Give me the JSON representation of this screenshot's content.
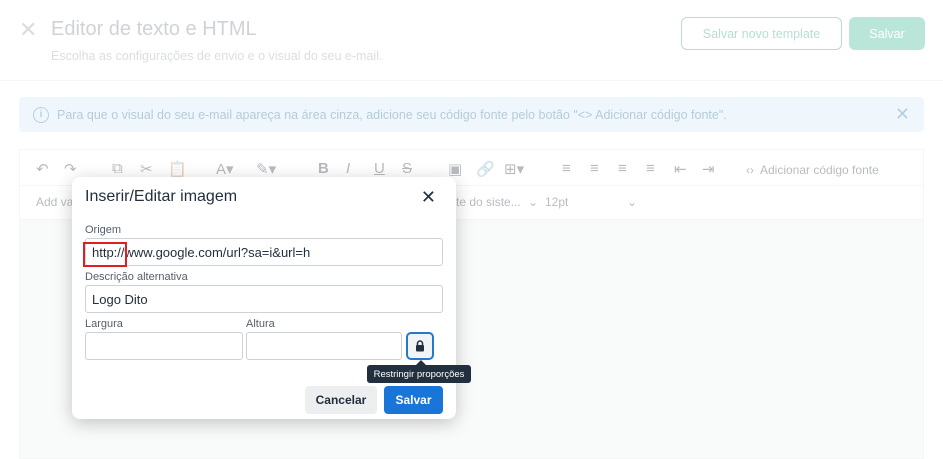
{
  "header": {
    "title": "Editor de texto e HTML",
    "subtitle": "Escolha as configurações de envio e o visual do seu e-mail.",
    "save_template_label": "Salvar novo template",
    "save_label": "Salvar"
  },
  "info": {
    "text": "Para que o visual do seu e-mail apareça na área cinza, adicione seu código fonte pelo botão \"<> Adicionar código fonte\"."
  },
  "toolbar": {
    "add_code_label": "Adicionar código fonte",
    "add_var_label": "Add va",
    "font_family_value": "te do siste...",
    "font_size_value": "12pt"
  },
  "modal": {
    "title": "Inserir/Editar imagem",
    "source_label": "Origem",
    "source_value": "http://www.google.com/url?sa=i&url=h",
    "alt_label": "Descrição alternativa",
    "alt_value": "Logo Dito",
    "width_label": "Largura",
    "width_value": "",
    "height_label": "Altura",
    "height_value": "",
    "lock_tooltip": "Restringir proporções",
    "cancel_label": "Cancelar",
    "save_label": "Salvar"
  }
}
